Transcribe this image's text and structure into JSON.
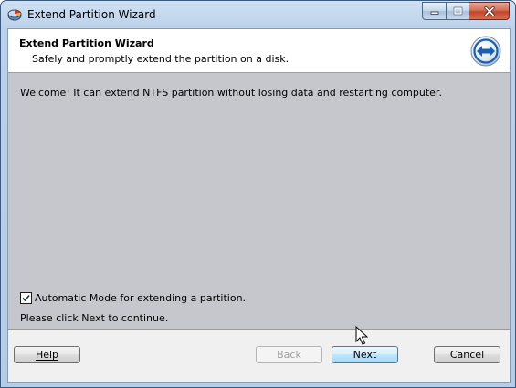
{
  "window": {
    "title": "Extend Partition Wizard"
  },
  "header": {
    "title": "Extend Partition Wizard",
    "subtitle": "Safely and promptly extend the partition on a disk.",
    "icon": "double-arrow-icon"
  },
  "panel": {
    "welcome_text": "Welcome! It can extend NTFS partition without losing data and restarting computer.",
    "auto_mode": {
      "label": "Automatic Mode for extending a partition.",
      "checked": true
    },
    "continue_text": "Please click Next to continue."
  },
  "buttons": {
    "help": {
      "label": "Help",
      "mnemonic": "H"
    },
    "back": {
      "label": "Back",
      "mnemonic": "B",
      "enabled": false
    },
    "next": {
      "label": "Next",
      "mnemonic": "N"
    },
    "cancel": {
      "label": "Cancel",
      "mnemonic": "C"
    }
  },
  "colors": {
    "panel_bg": "#c6c7cd",
    "header_bg": "#ffffff",
    "accent": "#1b5fb0"
  }
}
